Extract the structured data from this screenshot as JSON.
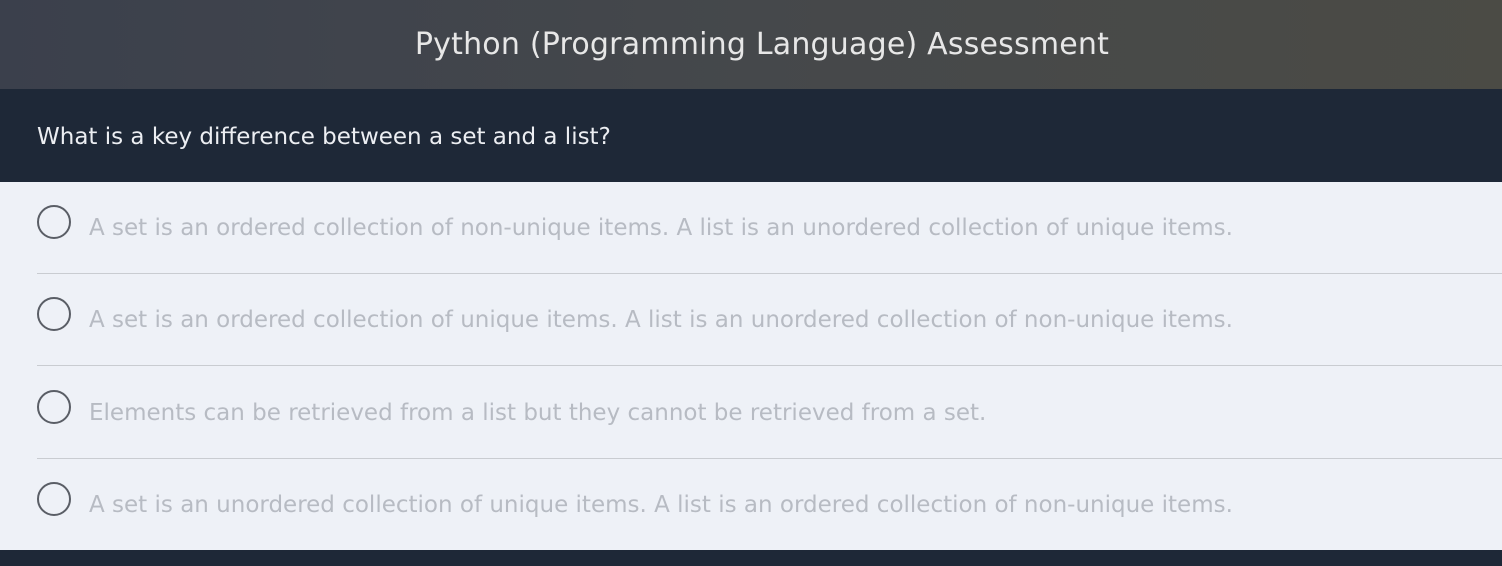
{
  "header": {
    "title": "Python (Programming Language) Assessment"
  },
  "question": {
    "text": "What is a key difference between a set and a list?"
  },
  "options": [
    {
      "label": "A set is an ordered collection of non-unique items. A list is an unordered collection of unique items.",
      "selected": false
    },
    {
      "label": "A set is an ordered collection of unique items. A list is an unordered collection of non-unique items.",
      "selected": false
    },
    {
      "label": "Elements can be retrieved from a list but they cannot be retrieved from a set.",
      "selected": false
    },
    {
      "label": "A set is an unordered collection of unique items. A list is an ordered collection of non-unique items.",
      "selected": false
    }
  ],
  "colors": {
    "header_gradient_start": "#3b404c",
    "header_gradient_end": "#4b4b45",
    "question_bar": "#1e2837",
    "options_background": "#eef1f7",
    "option_text": "#b7bbc3",
    "radio_border": "#5a5e66"
  }
}
